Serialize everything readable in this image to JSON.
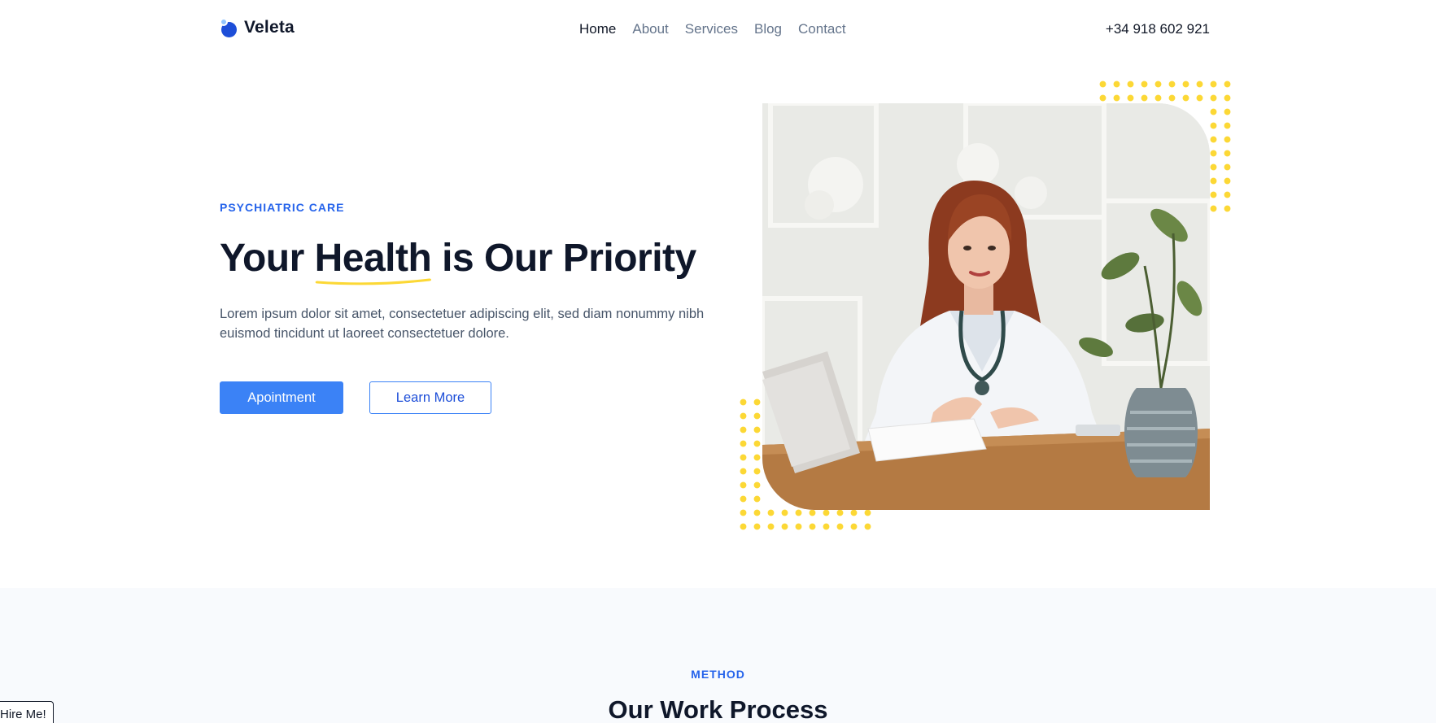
{
  "brand": {
    "name": "Veleta"
  },
  "nav": {
    "items": [
      {
        "label": "Home",
        "active": true
      },
      {
        "label": "About",
        "active": false
      },
      {
        "label": "Services",
        "active": false
      },
      {
        "label": "Blog",
        "active": false
      },
      {
        "label": "Contact",
        "active": false
      }
    ]
  },
  "header": {
    "phone": "+34 918 602 921"
  },
  "hero": {
    "eyebrow": "PSYCHIATRIC CARE",
    "headline_before": "Your ",
    "headline_highlight": "Health",
    "headline_after": " is Our Priority",
    "lead": "Lorem ipsum dolor sit amet, consectetuer adipiscing elit, sed diam nonummy nibh euismod tincidunt ut laoreet consectetuer dolore.",
    "primary_button": "Apointment",
    "secondary_button": "Learn More",
    "image_icon": "doctor-photo"
  },
  "method": {
    "eyebrow": "METHOD",
    "title": "Our Work Process"
  },
  "floating": {
    "hire_label": "Hire Me!"
  },
  "colors": {
    "accent": "#3b82f6",
    "accent_dark": "#1d4ed8",
    "dots": "#fcd835",
    "heading": "#0f172a",
    "muted": "#64748b",
    "section_bg": "#f8fafd"
  }
}
